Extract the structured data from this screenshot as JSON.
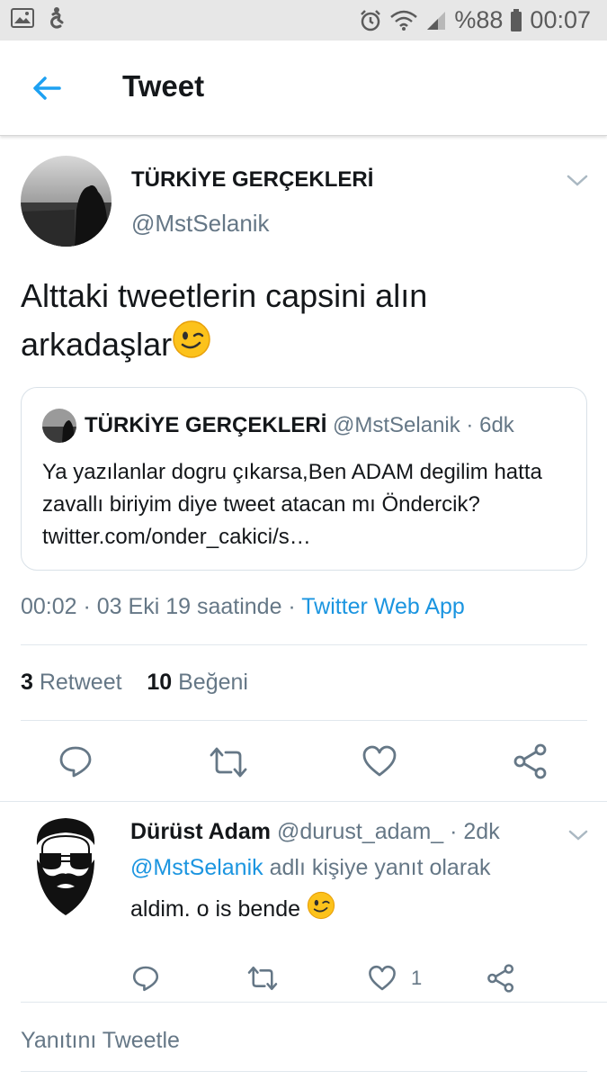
{
  "status_bar": {
    "battery_percent": "%88",
    "time": "00:07",
    "icons": [
      "image-icon",
      "accessibility-icon",
      "alarm-icon",
      "wifi-icon",
      "signal-icon",
      "battery-icon"
    ]
  },
  "header": {
    "title": "Tweet",
    "back_icon": "arrow-left-icon"
  },
  "tweet": {
    "author_name": "TÜRKİYE GERÇEKLERİ",
    "author_handle": "@MstSelanik",
    "text": "Alttaki tweetlerin capsini alın arkadaşlar",
    "text_emoji": "winking-face",
    "quoted": {
      "author_name": "TÜRKİYE GERÇEKLERİ",
      "meta": " @MstSelanik · 6dk",
      "text": "Ya yazılanlar dogru çıkarsa,Ben ADAM degilim hatta zavallı biriyim diye tweet atacan mı Öndercik? twitter.com/onder_cakici/s…"
    },
    "timestamp": "00:02 · 03 Eki 19 saatinde · ",
    "source": "Twitter Web App",
    "retweet_count": "3",
    "retweet_label": " Retweet",
    "like_count": "10",
    "like_label": " Beğeni",
    "accent_color": "#1b95e0"
  },
  "reply": {
    "author_name": "Dürüst Adam",
    "meta": " @durust_adam_ · 2dk",
    "reply_to_handle": "@MstSelanik",
    "reply_to_suffix": " adlı kişiye yanıt olarak",
    "text": "aldim. o is bende",
    "text_emoji": "winking-face",
    "likes": "1"
  },
  "compose": {
    "placeholder": "Yanıtını Tweetle"
  }
}
